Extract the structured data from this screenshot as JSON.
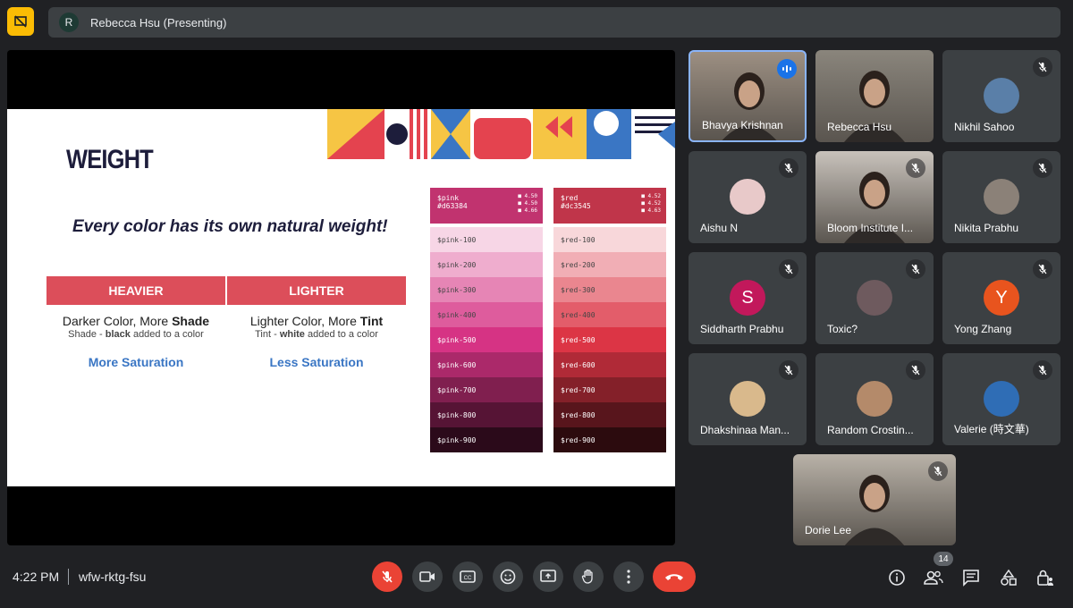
{
  "top": {
    "presenter_initial": "R",
    "presenter_title": "Rebecca Hsu (Presenting)"
  },
  "slide": {
    "title": "WEIGHT",
    "subtitle": "Every color has its own natural weight!",
    "columns": [
      {
        "header": "HEAVIER",
        "main_prefix": "Darker Color, More ",
        "main_bold": "Shade",
        "small_prefix": "Shade - ",
        "small_bold": "black",
        "small_suffix": " added to a color",
        "saturation": "More Saturation"
      },
      {
        "header": "LIGHTER",
        "main_prefix": "Lighter Color, More ",
        "main_bold": "Tint",
        "small_prefix": "Tint - ",
        "small_bold": "white",
        "small_suffix": " added to a color",
        "saturation": "Less Saturation"
      }
    ],
    "palettes": [
      {
        "name": "$pink",
        "hex": "#d63384",
        "ratios": [
          "4.50",
          "4.50",
          "4.66"
        ],
        "head_color": "#c1336f",
        "cells": [
          {
            "label": "$pink-100",
            "color": "#f7d6e6",
            "text": "#444"
          },
          {
            "label": "$pink-200",
            "color": "#efadce",
            "text": "#444"
          },
          {
            "label": "$pink-300",
            "color": "#e685b5",
            "text": "#444"
          },
          {
            "label": "$pink-400",
            "color": "#de5c9d",
            "text": "#444"
          },
          {
            "label": "$pink-500",
            "color": "#d63384",
            "text": "#fff"
          },
          {
            "label": "$pink-600",
            "color": "#ab296a",
            "text": "#fff"
          },
          {
            "label": "$pink-700",
            "color": "#801f4f",
            "text": "#fff"
          },
          {
            "label": "$pink-800",
            "color": "#561435",
            "text": "#fff"
          },
          {
            "label": "$pink-900",
            "color": "#2b0a1a",
            "text": "#fff"
          }
        ]
      },
      {
        "name": "$red",
        "hex": "#dc3545",
        "ratios": [
          "4.52",
          "4.52",
          "4.63"
        ],
        "head_color": "#c0354a",
        "cells": [
          {
            "label": "$red-100",
            "color": "#f8d7da",
            "text": "#444"
          },
          {
            "label": "$red-200",
            "color": "#f1aeb5",
            "text": "#444"
          },
          {
            "label": "$red-300",
            "color": "#ea868f",
            "text": "#444"
          },
          {
            "label": "$red-400",
            "color": "#e35d6a",
            "text": "#444"
          },
          {
            "label": "$red-500",
            "color": "#dc3545",
            "text": "#fff"
          },
          {
            "label": "$red-600",
            "color": "#b02a37",
            "text": "#fff"
          },
          {
            "label": "$red-700",
            "color": "#842029",
            "text": "#fff"
          },
          {
            "label": "$red-800",
            "color": "#58151c",
            "text": "#fff"
          },
          {
            "label": "$red-900",
            "color": "#2c0b0e",
            "text": "#fff"
          }
        ]
      }
    ]
  },
  "participants": [
    {
      "name": "Bhavya Krishnan",
      "kind": "video",
      "speaking": true,
      "bg": "#9c8f82"
    },
    {
      "name": "Rebecca Hsu",
      "kind": "video",
      "speaking": false,
      "muted": false,
      "bg": "#8a857c"
    },
    {
      "name": "Nikhil Sahoo",
      "kind": "avatar",
      "muted": true,
      "avatar_color": "#5a7fa8"
    },
    {
      "name": "Aishu N",
      "kind": "avatar",
      "muted": true,
      "avatar_color": "#e8c9c9"
    },
    {
      "name": "Bloom Institute I...",
      "kind": "video",
      "muted": true,
      "bg": "#c8c2bb"
    },
    {
      "name": "Nikita Prabhu",
      "kind": "avatar",
      "muted": true,
      "avatar_color": "#8b8178"
    },
    {
      "name": "Siddharth Prabhu",
      "kind": "letter",
      "muted": true,
      "letter": "S",
      "avatar_color": "#c2185b"
    },
    {
      "name": "Toxic?",
      "kind": "avatar",
      "muted": true,
      "avatar_color": "#6e5a5e"
    },
    {
      "name": "Yong Zhang",
      "kind": "letter",
      "muted": true,
      "letter": "Y",
      "avatar_color": "#e8541e"
    },
    {
      "name": "Dhakshinaa Man...",
      "kind": "avatar",
      "muted": true,
      "avatar_color": "#d9b98c"
    },
    {
      "name": "Random Crostin...",
      "kind": "avatar",
      "muted": true,
      "avatar_color": "#b48a6a"
    },
    {
      "name": "Valerie (時文華)",
      "kind": "avatar",
      "muted": true,
      "avatar_color": "#2f6db5"
    },
    {
      "name": "Dorie Lee",
      "kind": "video",
      "muted": true,
      "bg": "#b9b2a8"
    }
  ],
  "bottom": {
    "time": "4:22 PM",
    "meeting_code": "wfw-rktg-fsu",
    "people_count": "14"
  }
}
